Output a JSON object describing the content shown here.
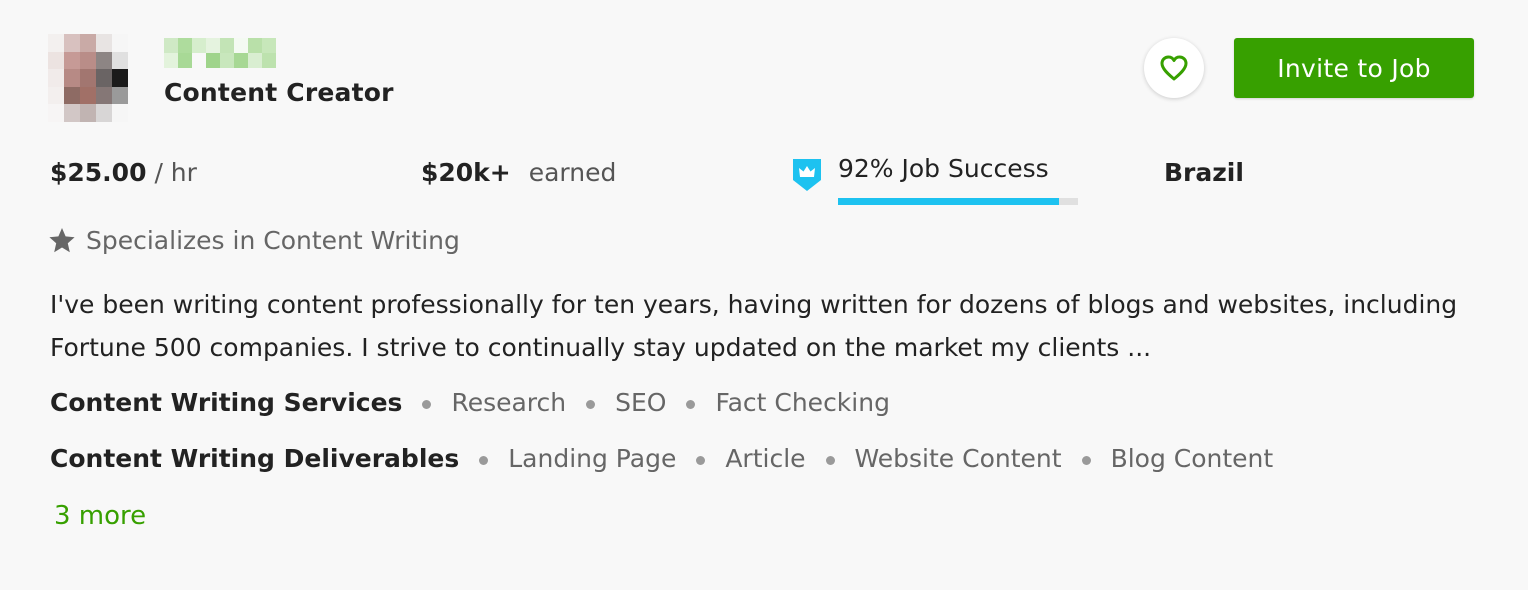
{
  "freelancer": {
    "title": "Content Creator",
    "rate_value": "$25.00",
    "rate_unit": "/ hr",
    "earned_value": "$20k+",
    "earned_label": "earned",
    "job_success_text": "92% Job Success",
    "job_success_percent": 92,
    "country": "Brazil",
    "specializes": "Specializes in Content Writing",
    "description": "I've been writing content professionally for ten years, having written for dozens of blogs and websites, including Fortune 500 companies. I strive to continually stay updated on the market my clients ...",
    "more_link": "3 more"
  },
  "actions": {
    "invite_label": "Invite to Job",
    "favorite_icon": "heart-icon"
  },
  "skills": [
    {
      "category": "Content Writing Services",
      "tags": [
        "Research",
        "SEO",
        "Fact Checking"
      ]
    },
    {
      "category": "Content Writing Deliverables",
      "tags": [
        "Landing Page",
        "Article",
        "Website Content",
        "Blog Content"
      ]
    }
  ],
  "colors": {
    "accent": "#37a000",
    "jss_bar": "#1dc2f0",
    "badge": "#1dc2f0",
    "background": "#f8f8f8"
  }
}
